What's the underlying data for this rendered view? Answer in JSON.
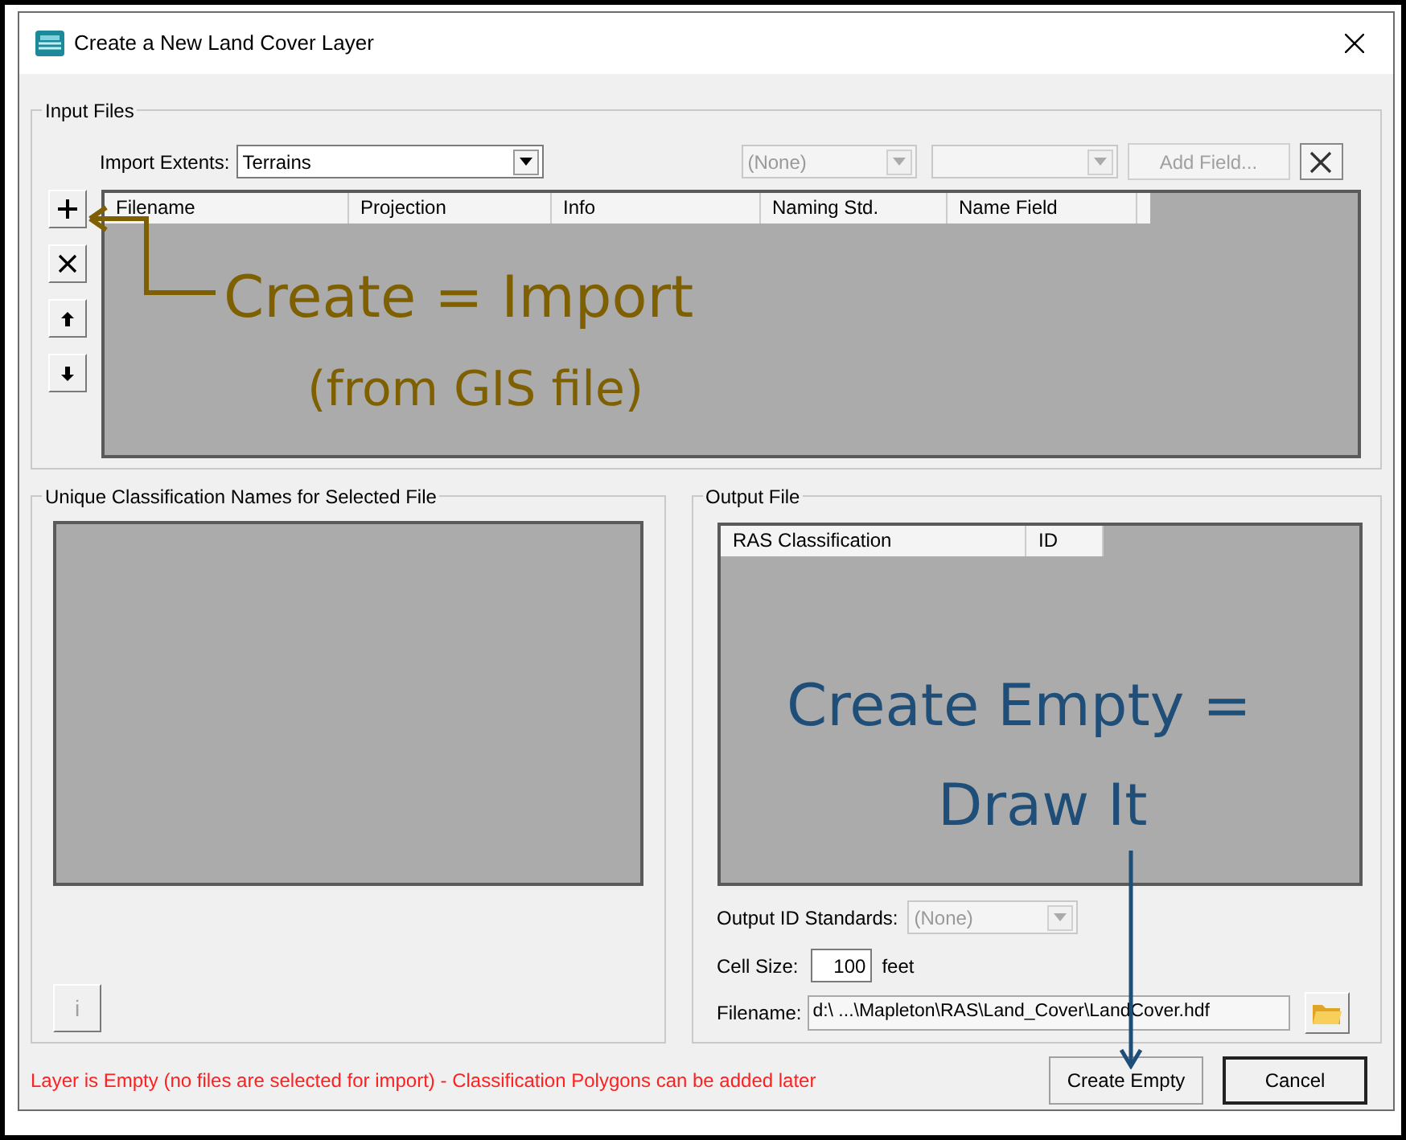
{
  "window": {
    "title": "Create a New Land Cover Layer"
  },
  "input_files": {
    "legend": "Input Files",
    "import_extents": {
      "label": "Import Extents:",
      "value": "Terrains"
    },
    "naming_dropdown": {
      "value": "(None)",
      "disabled": true
    },
    "field_dropdown": {
      "disabled": true
    },
    "add_field_button": {
      "label": "Add Field...",
      "disabled": true
    },
    "side_buttons": [
      {
        "kind": "add"
      },
      {
        "kind": "delete"
      },
      {
        "kind": "up"
      },
      {
        "kind": "down"
      }
    ],
    "columns": [
      "Filename",
      "Projection",
      "Info",
      "Naming Std.",
      "Name Field"
    ]
  },
  "classification_names": {
    "legend": "Unique Classification Names for Selected File",
    "info_button": {
      "label": "i",
      "disabled": true
    }
  },
  "output_file": {
    "legend": "Output File",
    "columns": [
      "RAS Classification",
      "ID"
    ],
    "output_id_standards": {
      "label": "Output ID Standards:",
      "value": "(None)",
      "disabled": true
    },
    "cell_size": {
      "label": "Cell Size:",
      "value": "100",
      "unit": "feet"
    },
    "filename": {
      "label": "Filename:",
      "value": "d:\\ ...\\Mapleton\\RAS\\Land_Cover\\LandCover.hdf"
    }
  },
  "status_message": "Layer is Empty (no files are selected for import) - Classification Polygons can be added later",
  "buttons": [
    {
      "label": "Create Empty",
      "default": false
    },
    {
      "label": "Cancel",
      "default": true
    }
  ],
  "annotations": [
    {
      "kind": "import",
      "lines": [
        "Create = Import",
        "(from GIS file)"
      ],
      "color": "#7f6000"
    },
    {
      "kind": "empty",
      "lines": [
        "Create Empty =",
        "Draw It"
      ],
      "color": "#1f4e79"
    }
  ]
}
